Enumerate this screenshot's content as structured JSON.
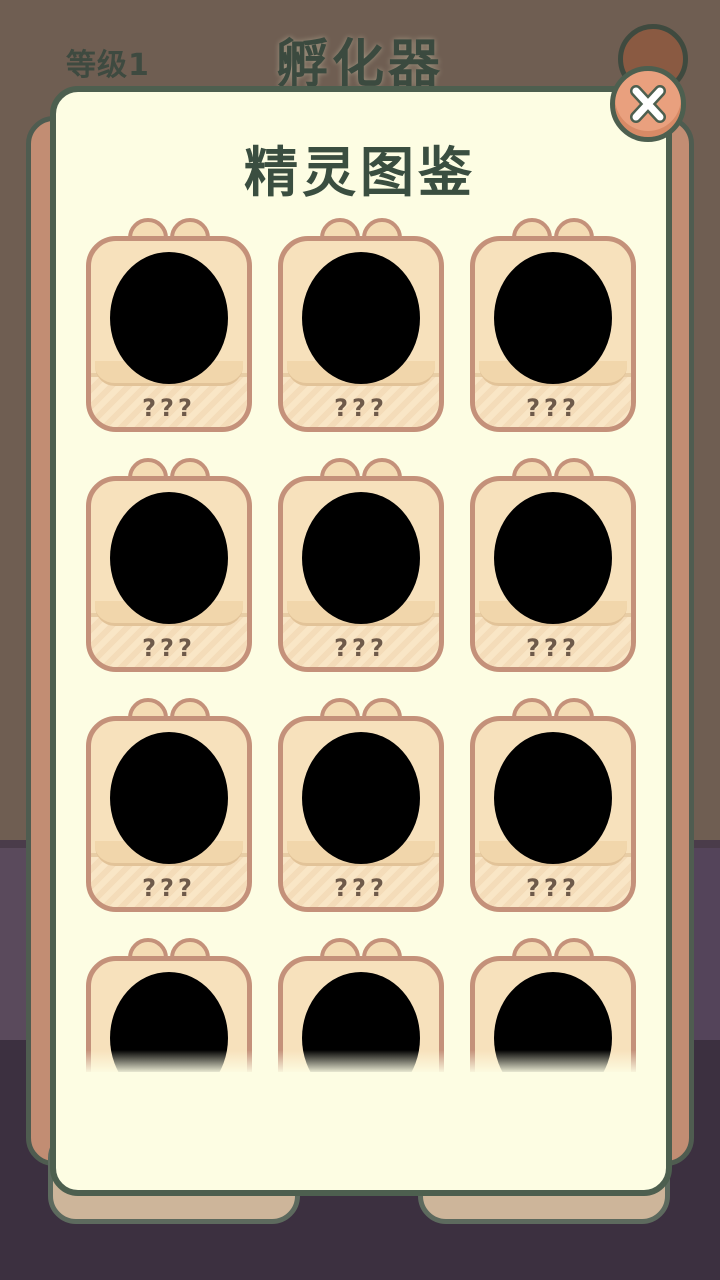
{
  "hud": {
    "level": "等级1",
    "title": "孵化器"
  },
  "dialog": {
    "title": "精灵图鉴",
    "close_icon": "close-x-icon",
    "entries": [
      {
        "name": "???"
      },
      {
        "name": "???"
      },
      {
        "name": "???"
      },
      {
        "name": "???"
      },
      {
        "name": "???"
      },
      {
        "name": "???"
      },
      {
        "name": "???"
      },
      {
        "name": "???"
      },
      {
        "name": "???"
      },
      {
        "name": "???"
      },
      {
        "name": "???"
      },
      {
        "name": "???"
      }
    ]
  },
  "colors": {
    "panel": "#fdfde3",
    "panel_border": "#4d5f4f",
    "close_button": "#e9a07e",
    "card": "#f7e1bc",
    "card_border": "#c4917a",
    "silhouette": "#000000"
  }
}
